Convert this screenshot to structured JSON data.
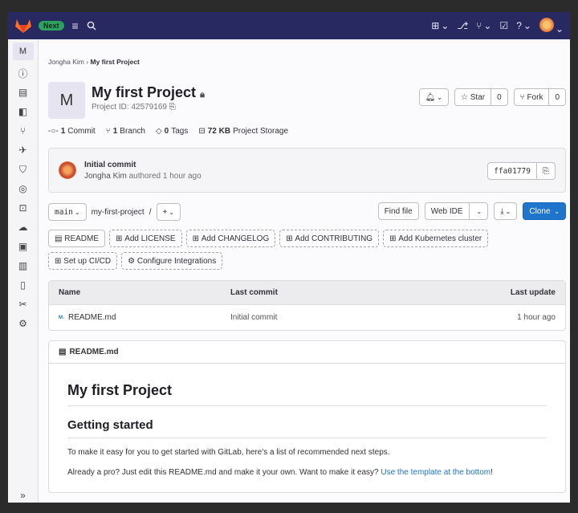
{
  "topbar": {
    "next_badge": "Next",
    "menu_icon": "hamburger-icon",
    "search_icon": "search-icon",
    "right_icons": [
      "plus-square-icon",
      "merge-request-icon",
      "todo-icon",
      "help-icon",
      "user-avatar"
    ]
  },
  "sidebar": {
    "project_initial": "M",
    "items": [
      "project-info-icon",
      "repository-icon",
      "issues-icon",
      "merge-requests-icon",
      "cicd-icon",
      "security-icon",
      "deployments-icon",
      "packages-icon",
      "infrastructure-icon",
      "monitor-icon",
      "analytics-icon",
      "wiki-icon",
      "snippets-icon",
      "settings-icon"
    ],
    "collapse_label": "»"
  },
  "breadcrumb": {
    "owner": "Jongha Kim",
    "separator": "›",
    "project": "My first Project"
  },
  "project": {
    "initial": "M",
    "title": "My first Project",
    "id_label": "Project ID: 42579169",
    "star_label": "Star",
    "star_count": "0",
    "fork_label": "Fork",
    "fork_count": "0"
  },
  "stats": {
    "commits_count": "1",
    "commits_label": "Commit",
    "branches_count": "1",
    "branches_label": "Branch",
    "tags_count": "0",
    "tags_label": "Tags",
    "storage_size": "72 KB",
    "storage_label": "Project Storage"
  },
  "last_commit": {
    "title": "Initial commit",
    "author": "Jongha Kim",
    "meta": "authored 1 hour ago",
    "sha": "ffa01779"
  },
  "ref_bar": {
    "branch": "main",
    "path": "my-first-project",
    "path_sep": "/",
    "add_label": "+",
    "find_file": "Find file",
    "web_ide": "Web IDE",
    "clone": "Clone"
  },
  "quick_actions": {
    "readme": "README",
    "add_license": "Add LICENSE",
    "add_changelog": "Add CHANGELOG",
    "add_contributing": "Add CONTRIBUTING",
    "add_k8s": "Add Kubernetes cluster",
    "setup_cicd": "Set up CI/CD",
    "configure_integrations": "Configure Integrations"
  },
  "file_table": {
    "headers": {
      "name": "Name",
      "last_commit": "Last commit",
      "last_update": "Last update"
    },
    "rows": [
      {
        "icon": "M↓",
        "name": "README.md",
        "last_commit": "Initial commit",
        "last_update": "1 hour ago"
      }
    ]
  },
  "readme": {
    "filename": "README.md",
    "h1": "My first Project",
    "h2": "Getting started",
    "p1": "To make it easy for you to get started with GitLab, here's a list of recommended next steps.",
    "p2_text": "Already a pro? Just edit this README.md and make it your own. Want to make it easy? ",
    "p2_link": "Use the template at the bottom",
    "p2_end": "!"
  },
  "colors": {
    "topbar_bg": "#292961",
    "primary": "#1f75cb",
    "next_badge": "#2da160"
  }
}
